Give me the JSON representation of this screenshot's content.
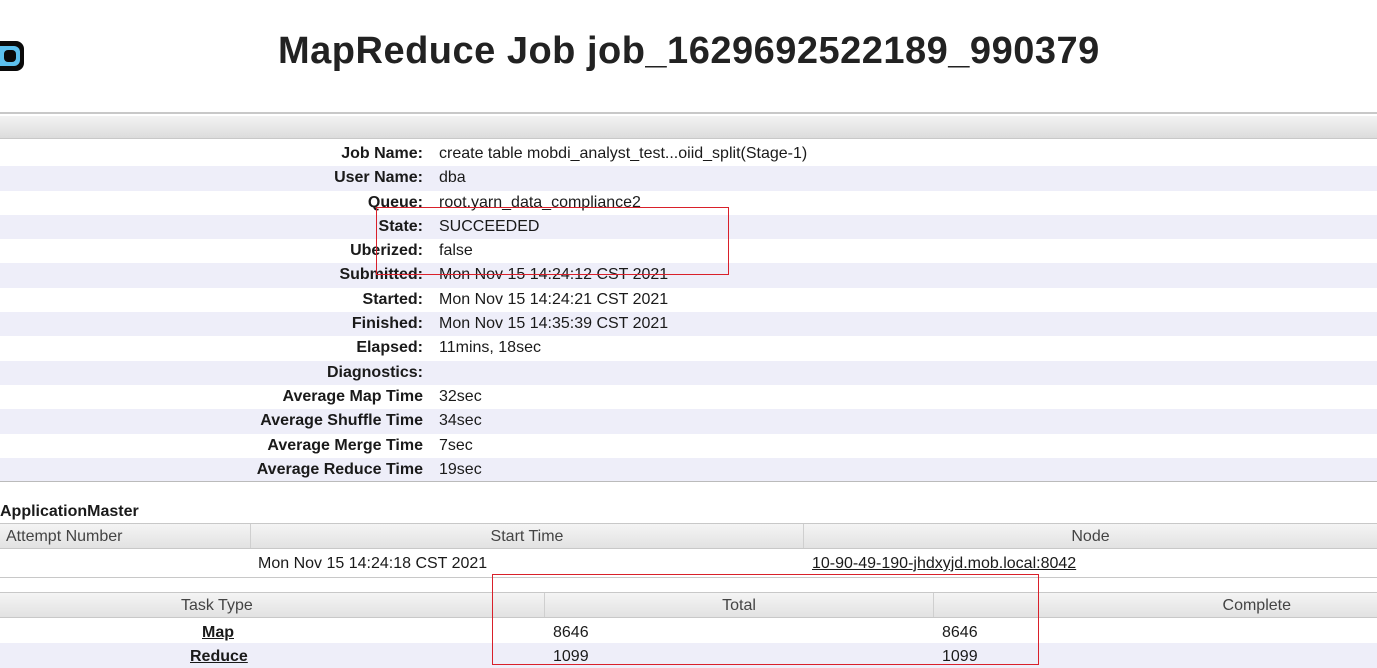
{
  "header": {
    "title": "MapReduce Job job_1629692522189_990379"
  },
  "job_info": {
    "rows": [
      {
        "label": "Job Name:",
        "value": "create table mobdi_analyst_test...oiid_split(Stage-1)"
      },
      {
        "label": "User Name:",
        "value": "dba"
      },
      {
        "label": "Queue:",
        "value": "root.yarn_data_compliance2"
      },
      {
        "label": "State:",
        "value": "SUCCEEDED"
      },
      {
        "label": "Uberized:",
        "value": "false"
      },
      {
        "label": "Submitted:",
        "value": "Mon Nov 15 14:24:12 CST 2021"
      },
      {
        "label": "Started:",
        "value": "Mon Nov 15 14:24:21 CST 2021"
      },
      {
        "label": "Finished:",
        "value": "Mon Nov 15 14:35:39 CST 2021"
      },
      {
        "label": "Elapsed:",
        "value": "11mins, 18sec"
      },
      {
        "label": "Diagnostics:",
        "value": ""
      },
      {
        "label": "Average Map Time",
        "value": "32sec"
      },
      {
        "label": "Average Shuffle Time",
        "value": "34sec"
      },
      {
        "label": "Average Merge Time",
        "value": "7sec"
      },
      {
        "label": "Average Reduce Time",
        "value": "19sec"
      }
    ]
  },
  "application_master": {
    "title": "ApplicationMaster",
    "headers": {
      "attempt": "Attempt Number",
      "start": "Start Time",
      "node": "Node"
    },
    "row": {
      "start": "Mon Nov 15 14:24:18 CST 2021",
      "node": "10-90-49-190-jhdxyjd.mob.local:8042"
    }
  },
  "tasks": {
    "headers": {
      "type": "Task Type",
      "total": "Total",
      "complete": "Complete"
    },
    "rows": [
      {
        "type": "Map",
        "total": "8646",
        "complete": "8646"
      },
      {
        "type": "Reduce",
        "total": "1099",
        "complete": "1099"
      }
    ]
  },
  "colors": {
    "highlight_box": "#d9202a",
    "odd_row": "#eeeef9"
  }
}
